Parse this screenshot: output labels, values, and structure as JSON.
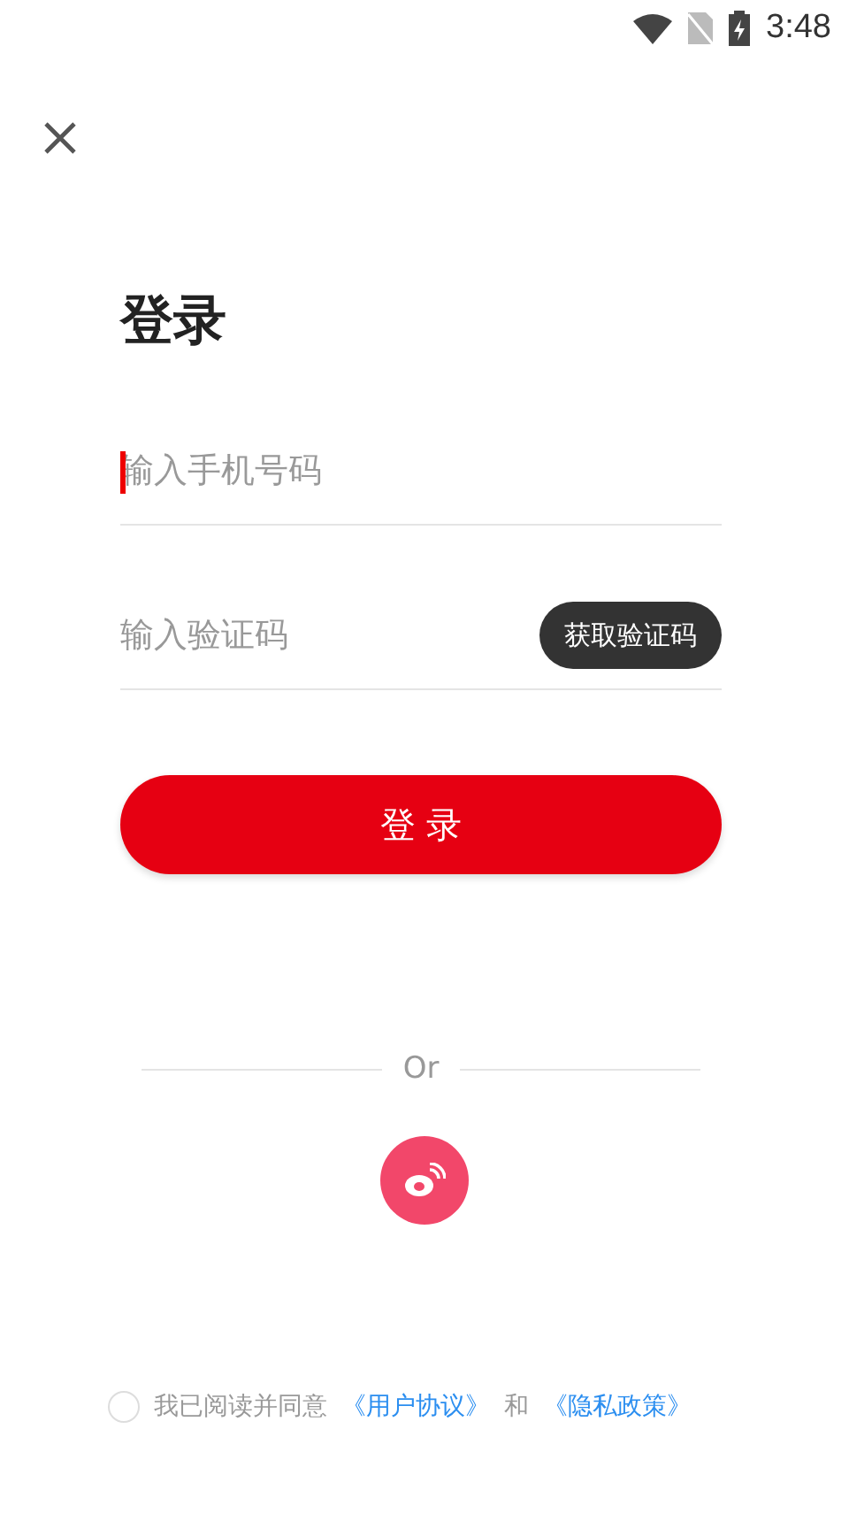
{
  "status_bar": {
    "time": "3:48"
  },
  "title": "登录",
  "fields": [
    {
      "placeholder": "输入手机号码",
      "focused": true
    },
    {
      "placeholder": "输入验证码",
      "focused": false,
      "button": "获取验证码"
    }
  ],
  "login_button": "登 录",
  "divider_text": "Or",
  "agreement": {
    "checked": false,
    "text": "我已阅读并同意",
    "links": [
      "《用户协议》",
      "《隐私政策》"
    ],
    "joiner": "和"
  }
}
